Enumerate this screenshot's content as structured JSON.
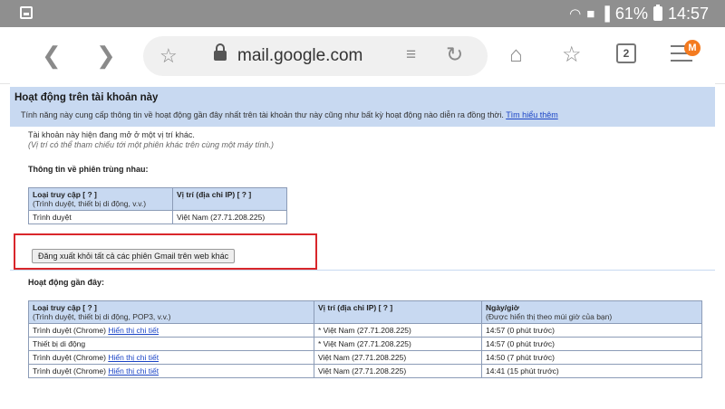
{
  "status_bar": {
    "battery": "61%",
    "time": "14:57"
  },
  "browser": {
    "url": "mail.google.com",
    "tab_count": "2",
    "avatar": "M"
  },
  "section": {
    "title": "Hoạt động trên tài khoản này",
    "description": "Tính năng này cung cấp thông tin về hoạt động gần đây nhất trên tài khoản thư này cũng như bất kỳ hoạt động nào diễn ra đồng thời.",
    "learn_more": "Tìm hiểu thêm"
  },
  "concurrent": {
    "line1": "Tài khoản này hiện đang mở ở một vị trí khác.",
    "line2": "(Vị trí có thể tham chiếu tới một phiên khác trên cùng một máy tính.)",
    "heading": "Thông tin về phiên trùng nhau:",
    "col1_title": "Loại truy cập [ ? ]",
    "col1_sub": "(Trình duyệt, thiết bị di động, v.v.)",
    "col2_title": "Vị trí (địa chỉ IP) [ ? ]",
    "row": {
      "type": "Trình duyệt",
      "location": "Việt Nam (27.71.208.225)"
    },
    "signout_button": "Đăng xuất khỏi tất cả các phiên Gmail trên web khác"
  },
  "recent": {
    "heading": "Hoạt động gần đây:",
    "col1_title": "Loại truy cập [ ? ]",
    "col1_sub": "(Trình duyệt, thiết bị di động, POP3, v.v.)",
    "col2_title": "Vị trí (địa chỉ IP) [ ? ]",
    "col3_title": "Ngày/giờ",
    "col3_sub": "(Được hiển thị theo múi giờ của bạn)",
    "detail_link": "Hiển thị chi tiết",
    "rows": [
      {
        "type": "Trình duyệt (Chrome)",
        "has_link": true,
        "location": "* Việt Nam (27.71.208.225)",
        "time": "14:57 (0 phút trước)"
      },
      {
        "type": "Thiết bị di động",
        "has_link": false,
        "location": "* Việt Nam (27.71.208.225)",
        "time": "14:57 (0 phút trước)"
      },
      {
        "type": "Trình duyệt (Chrome)",
        "has_link": true,
        "location": "Việt Nam (27.71.208.225)",
        "time": "14:50 (7 phút trước)"
      },
      {
        "type": "Trình duyệt (Chrome)",
        "has_link": true,
        "location": "Việt Nam (27.71.208.225)",
        "time": "14:41 (15 phút trước)"
      }
    ]
  }
}
